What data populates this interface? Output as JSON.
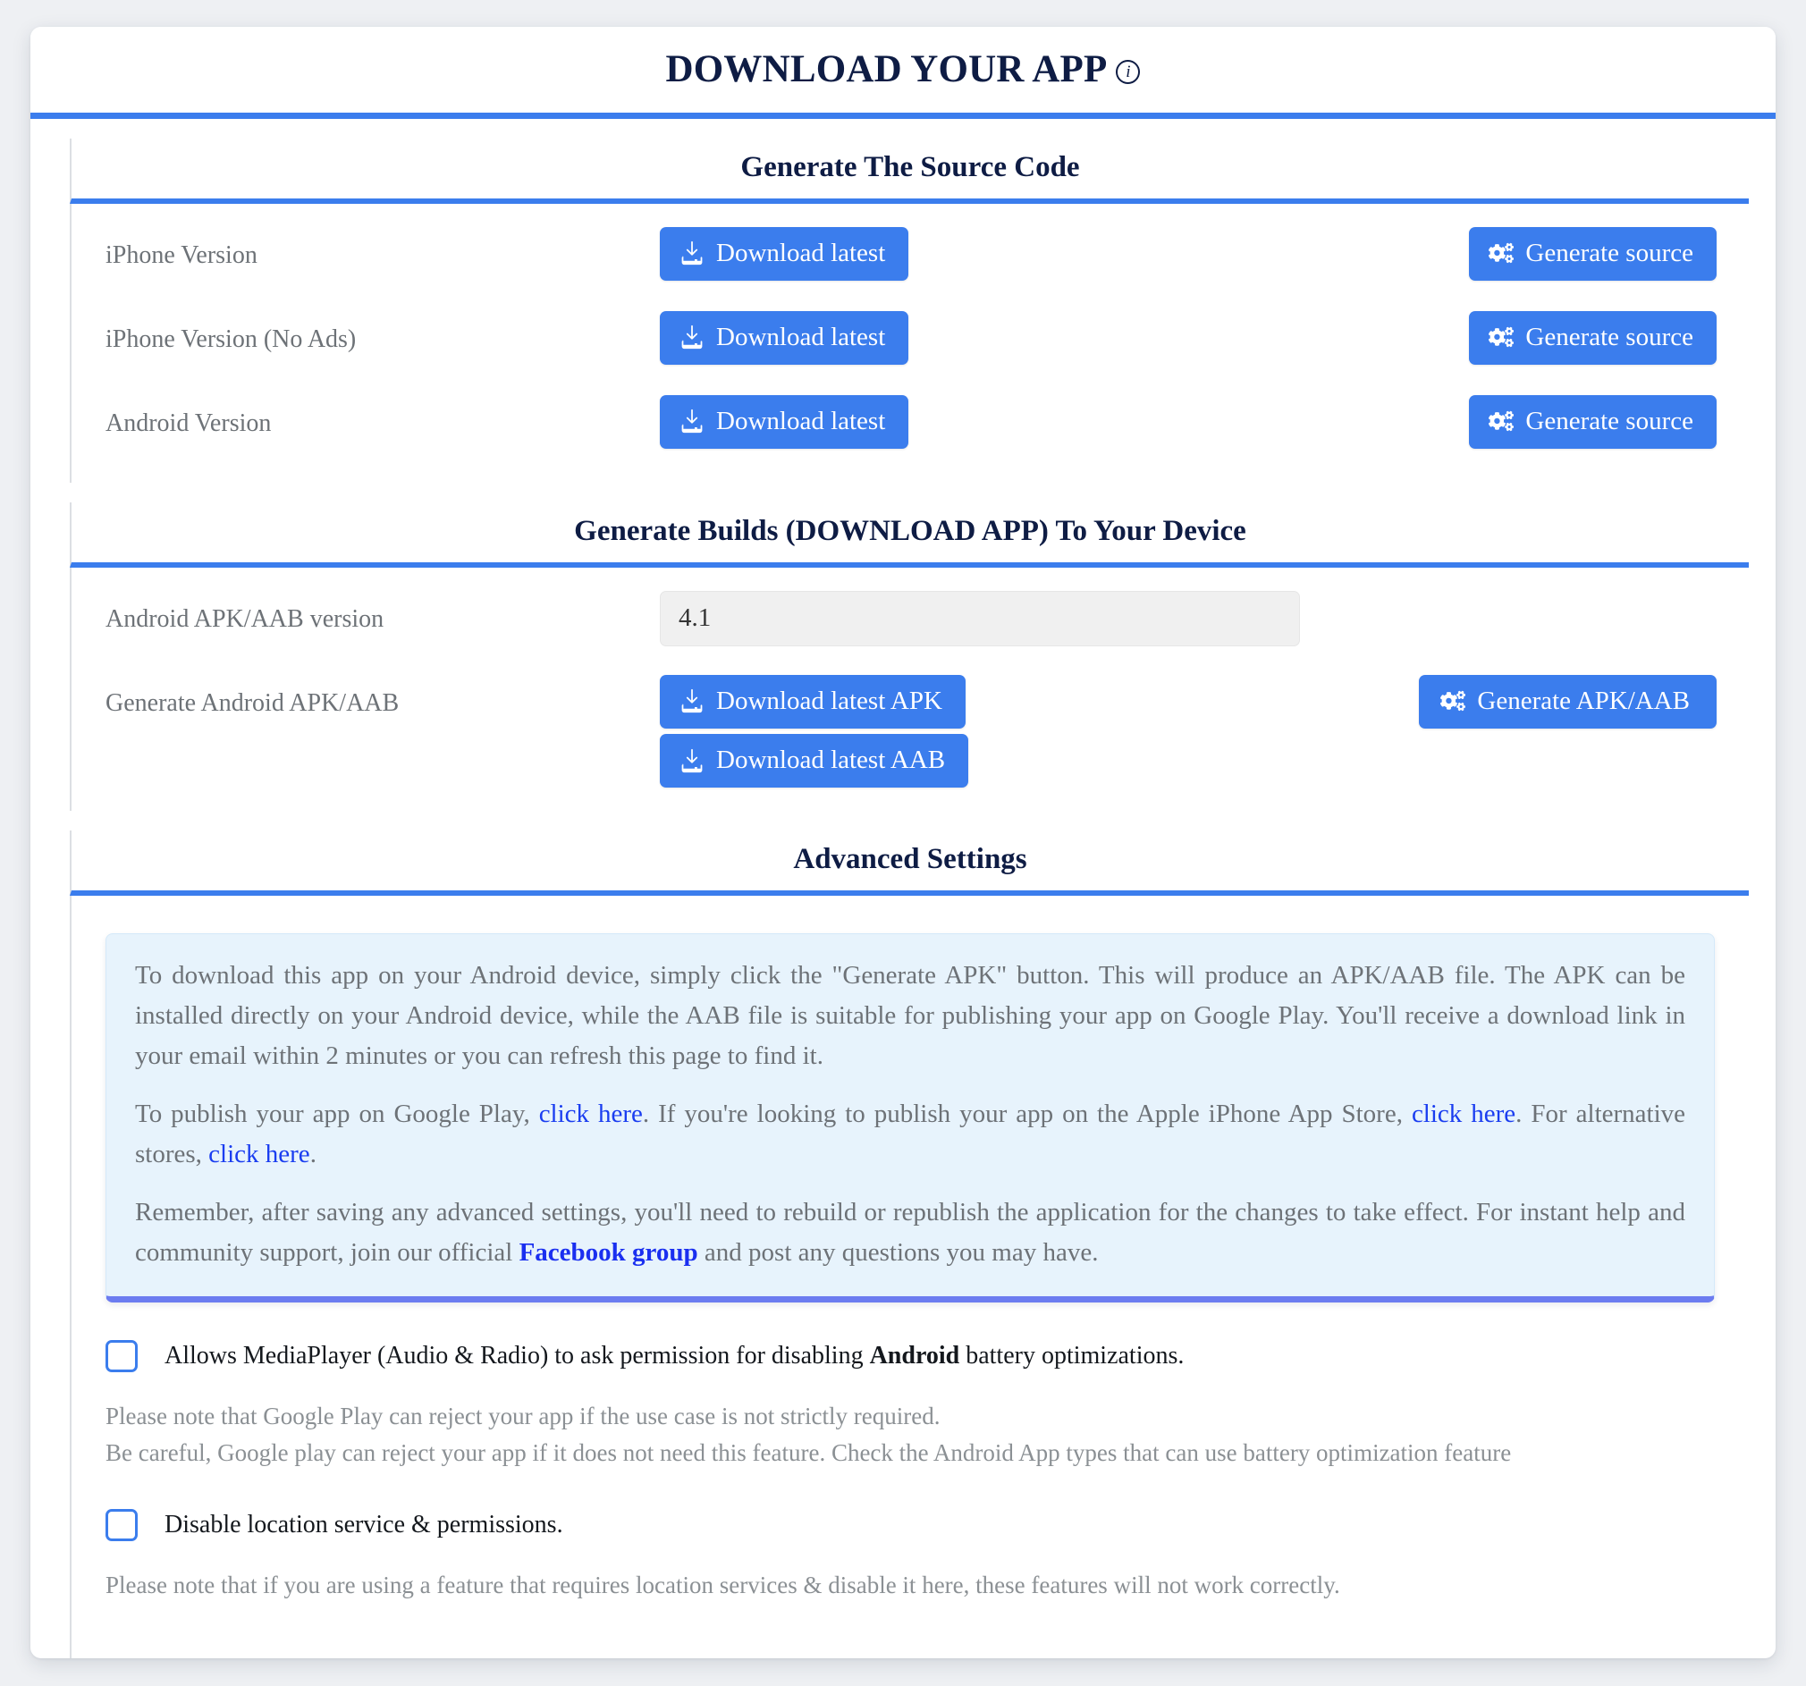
{
  "page": {
    "title": "DOWNLOAD YOUR APP",
    "info_icon": "info-icon",
    "accent_color": "#3b7ded",
    "title_color": "#0e1c44",
    "alert_bg": "#e7f3fc",
    "alert_border": "#6c7cf0",
    "link_color": "#1a3df0"
  },
  "source_section": {
    "heading": "Generate The Source Code",
    "rows": [
      {
        "label": "iPhone Version",
        "download_label": "Download latest",
        "generate_label": "Generate source"
      },
      {
        "label": "iPhone Version (No Ads)",
        "download_label": "Download latest",
        "generate_label": "Generate source"
      },
      {
        "label": "Android Version",
        "download_label": "Download latest",
        "generate_label": "Generate source"
      }
    ]
  },
  "builds_section": {
    "heading": "Generate Builds (DOWNLOAD APP) To Your Device",
    "version_label": "Android APK/AAB version",
    "version_value": "4.1",
    "version_placeholder": "",
    "generate_label": "Generate Android APK/AAB",
    "download_apk_label": "Download latest APK",
    "download_aab_label": "Download latest AAB",
    "generate_button_label": "Generate APK/AAB"
  },
  "advanced_section": {
    "heading": "Advanced Settings",
    "alert": {
      "p1_a": "To download this app on your Android device, simply click the \"Generate APK\" button. This will produce an APK/AAB file. The APK can be installed directly on your Android device, while the AAB file is suitable for publishing your app on Google Play. You'll receive a download link in your email within 2 minutes or you can refresh this page to find it.",
      "p2_a": "To publish your app on Google Play, ",
      "p2_link1": "click here",
      "p2_b": ". If you're looking to publish your app on the Apple iPhone App Store, ",
      "p2_link2": "click here",
      "p2_c": ". For alternative stores, ",
      "p2_link3": "click here",
      "p2_d": ".",
      "p3_a": "Remember, after saving any advanced settings, you'll need to rebuild or republish the application for the changes to take effect. For instant help and community support, join our official ",
      "p3_link": "Facebook group",
      "p3_b": " and post any questions you may have."
    },
    "checkbox1": {
      "label_a": "Allows MediaPlayer (Audio & Radio) to ask permission for disabling ",
      "label_bold": "Android",
      "label_b": " battery optimizations.",
      "checked": false,
      "note1": "Please note that Google Play can reject your app if the use case is not strictly required.",
      "note2": "Be careful, Google play can reject your app if it does not need this feature. Check the Android App types that can use battery optimization feature"
    },
    "checkbox2": {
      "label": "Disable location service & permissions.",
      "checked": false,
      "note1": "Please note that if you are using a feature that requires location services & disable it here, these features will not work correctly."
    }
  }
}
